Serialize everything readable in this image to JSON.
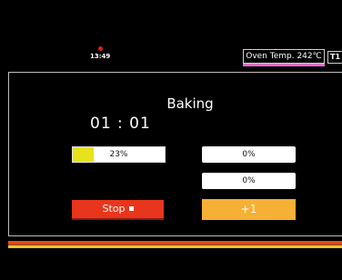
{
  "status": {
    "clock": "13:49",
    "oven_temp": "Oven Temp. 242℃",
    "tray_label": "T1"
  },
  "main": {
    "mode_title": "Baking",
    "timer": "01 : 01",
    "progress": {
      "label": "23%",
      "percent": 23
    },
    "values": [
      "0%",
      "0%"
    ],
    "stop_label": "Stop",
    "plus_label": "+1"
  },
  "colors": {
    "stop": "#e8361c",
    "plus": "#f5b035",
    "progress_fill": "#e8e21d",
    "indicator": "#e01b1b"
  }
}
